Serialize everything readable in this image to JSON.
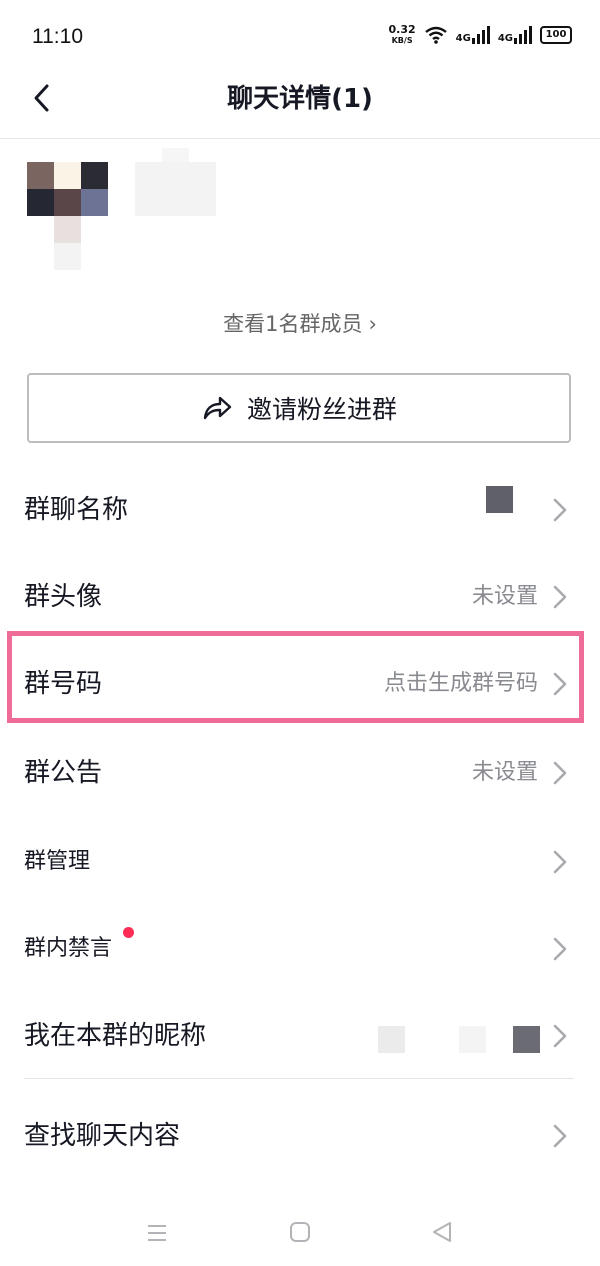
{
  "status": {
    "time": "11:10",
    "speed_value": "0.32",
    "speed_unit": "KB/S",
    "net1": "4G",
    "net2": "4G",
    "battery": "100"
  },
  "header": {
    "title": "聊天详情(1)"
  },
  "members": {
    "link": "查看1名群成员"
  },
  "invite": {
    "label": "邀请粉丝进群"
  },
  "settings": {
    "group_name": {
      "label": "群聊名称",
      "value": ""
    },
    "group_avatar": {
      "label": "群头像",
      "value": "未设置"
    },
    "group_number": {
      "label": "群号码",
      "value": "点击生成群号码"
    },
    "announcement": {
      "label": "群公告",
      "value": "未设置"
    },
    "management": {
      "label": "群管理"
    },
    "mute": {
      "label": "群内禁言"
    },
    "nickname": {
      "label": "我在本群的昵称",
      "value": ""
    },
    "search_chat": {
      "label": "查找聊天内容"
    }
  },
  "colors": {
    "highlight": "#ef6c98",
    "badge": "#fe2c55",
    "text": "#161823",
    "secondary": "#8a8b91"
  }
}
